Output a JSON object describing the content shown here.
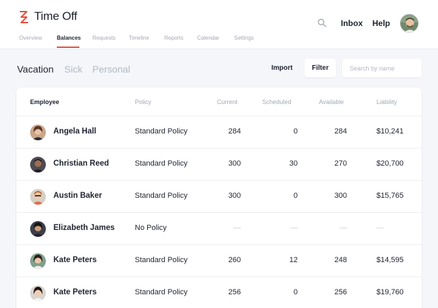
{
  "app": {
    "title": "Time Off",
    "brand_color": "#e84a3c"
  },
  "header": {
    "search_icon": "search-icon",
    "links": [
      "Inbox",
      "Help"
    ]
  },
  "nav": {
    "items": [
      "Overview",
      "Balances",
      "Requests",
      "Timeline",
      "Reports",
      "Calendar",
      "Settings"
    ],
    "active": "Balances"
  },
  "tabs": {
    "items": [
      "Vacation",
      "Sick",
      "Personal"
    ],
    "active": "Vacation"
  },
  "toolbar": {
    "import_label": "Import",
    "filter_label": "Filter",
    "search_placeholder": "Search by name"
  },
  "table": {
    "columns": [
      "Employee",
      "Policy",
      "Current",
      "Scheduled",
      "Available",
      "Liability"
    ],
    "rows": [
      {
        "name": "Angela Hall",
        "policy": "Standard Policy",
        "current": "284",
        "scheduled": "0",
        "available": "284",
        "liability": "$10,241"
      },
      {
        "name": "Christian Reed",
        "policy": "Standard Policy",
        "current": "300",
        "scheduled": "30",
        "available": "270",
        "liability": "$20,700"
      },
      {
        "name": "Austin Baker",
        "policy": "Standard Policy",
        "current": "300",
        "scheduled": "0",
        "available": "300",
        "liability": "$15,765"
      },
      {
        "name": "Elizabeth James",
        "policy": "No Policy",
        "current": "—",
        "scheduled": "—",
        "available": "—",
        "liability": "—"
      },
      {
        "name": "Kate Peters",
        "policy": "Standard Policy",
        "current": "260",
        "scheduled": "12",
        "available": "248",
        "liability": "$14,595"
      },
      {
        "name": "Kate Peters",
        "policy": "Standard Policy",
        "current": "256",
        "scheduled": "0",
        "available": "256",
        "liability": "$19,760"
      }
    ]
  }
}
